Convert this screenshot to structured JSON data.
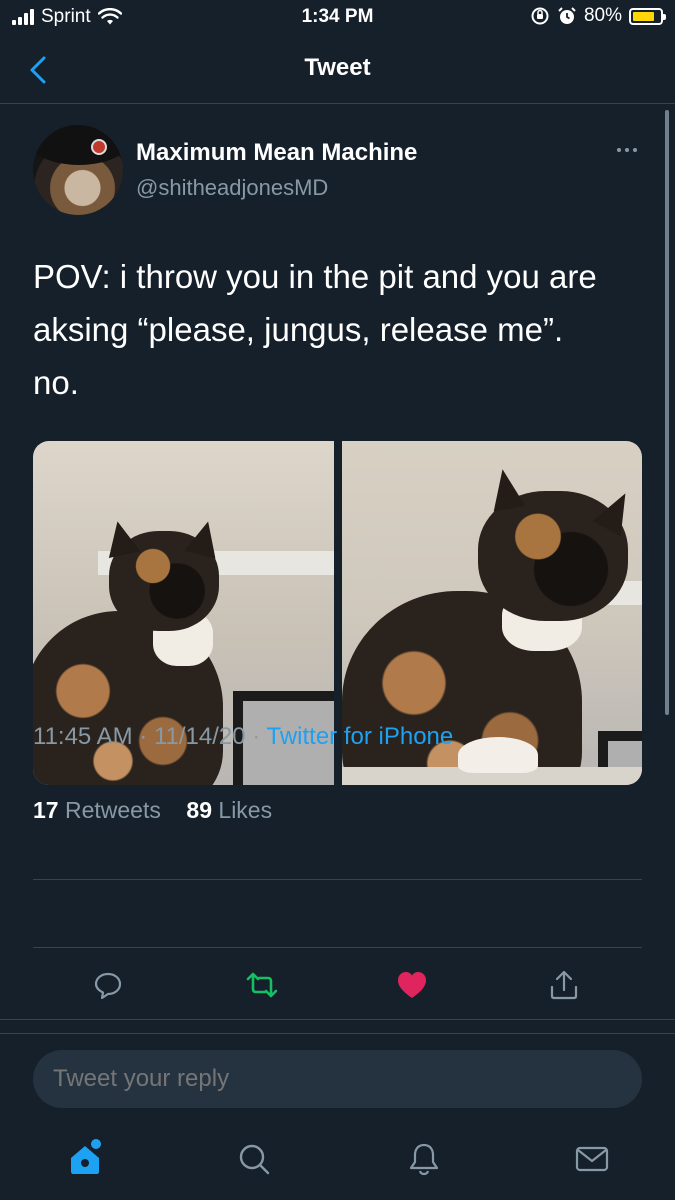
{
  "status_bar": {
    "carrier": "Sprint",
    "time": "1:34 PM",
    "battery": "80%",
    "battery_level": 0.8
  },
  "nav": {
    "title": "Tweet"
  },
  "tweet": {
    "author_name": "Maximum Mean Machine",
    "author_handle": "@shitheadjonesMD",
    "text": "POV: i throw you in the pit and you are\naksing “please, jungus, release me”.\nno.",
    "timestamp": "11:45 AM · 11/14/20 ·",
    "source": "Twitter for iPhone",
    "retweets_count": "17",
    "retweets_label": "Retweets",
    "likes_count": "89",
    "likes_label": "Likes"
  },
  "actions": {
    "reply_icon": "comment-icon",
    "retweet_icon": "retweet-icon",
    "like_icon": "heart-icon",
    "share_icon": "share-icon",
    "retweet_color": "#17bf63",
    "like_color": "#e0245e"
  },
  "reply": {
    "placeholder": "Tweet your reply"
  },
  "tab_bar": {
    "items": [
      "home-icon",
      "search-icon",
      "notifications-icon",
      "messages-icon"
    ],
    "accent": "#1da1f2"
  }
}
